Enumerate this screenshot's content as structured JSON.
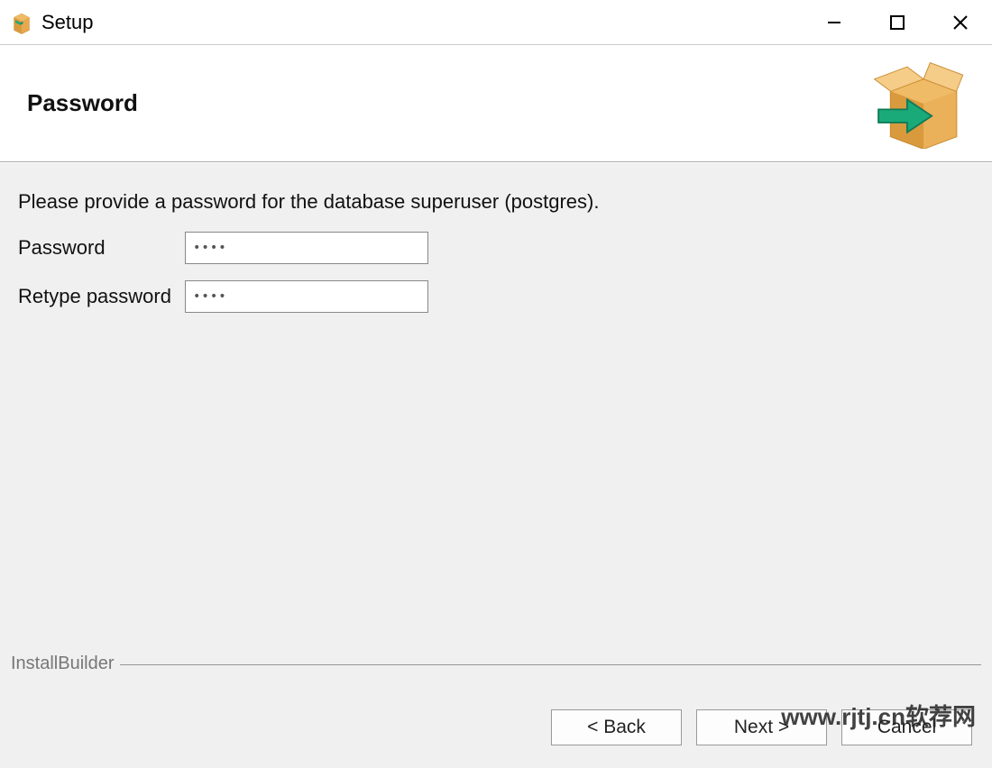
{
  "window": {
    "title": "Setup"
  },
  "header": {
    "title": "Password"
  },
  "content": {
    "instruction": "Please provide a password for the database superuser (postgres).",
    "password_label": "Password",
    "password_value": "••••",
    "retype_label": "Retype password",
    "retype_value": "••••"
  },
  "footer": {
    "builder_label": "InstallBuilder",
    "back_label": "< Back",
    "next_label": "Next >",
    "cancel_label": "Cancel"
  },
  "watermark": "www.rjtj.cn软荐网"
}
